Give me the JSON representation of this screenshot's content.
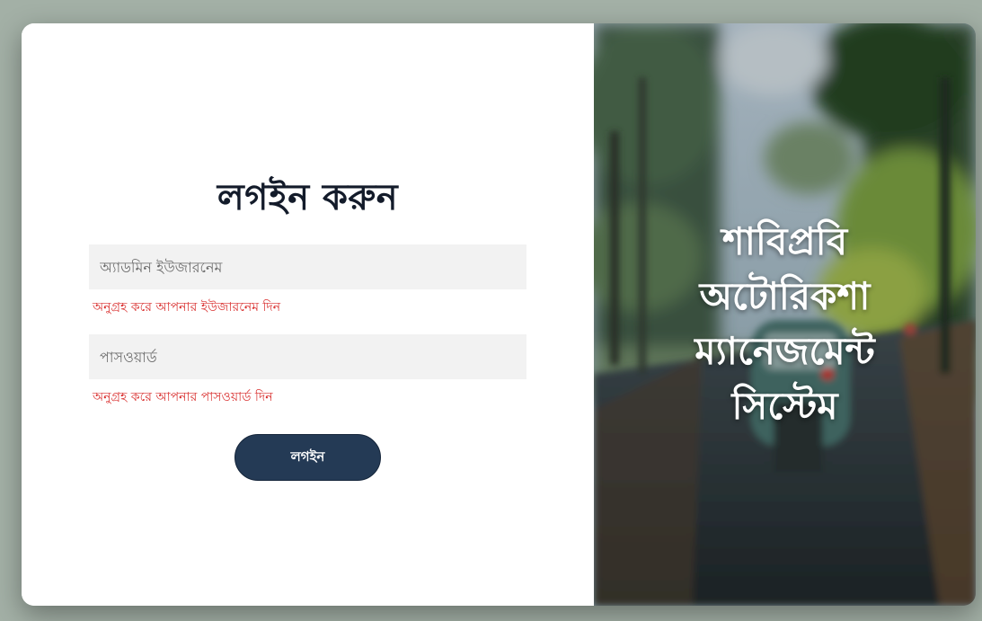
{
  "login": {
    "title": "লগইন করুন",
    "username_placeholder": "অ্যাডমিন ইউজারনেম",
    "username_value": "",
    "username_error": "অনুগ্রহ করে আপনার ইউজারনেম দিন",
    "password_placeholder": "পাসওয়ার্ড",
    "password_value": "",
    "password_error": "অনুগ্রহ করে আপনার পাসওয়ার্ড দিন",
    "button_label": "লগইন"
  },
  "brand": {
    "lines": [
      "শাবিপ্রবি",
      "অটোরিকশা",
      "ম্যানেজমেন্ট",
      "সিস্টেম"
    ]
  },
  "colors": {
    "background": "#a3b0a6",
    "title": "#131b2a",
    "error": "#d9302f",
    "button": "#243a55",
    "input_bg": "#f2f2f2"
  },
  "icons": {
    "hero": "blurred-road-with-trees-and-autorickshaw-photo"
  }
}
